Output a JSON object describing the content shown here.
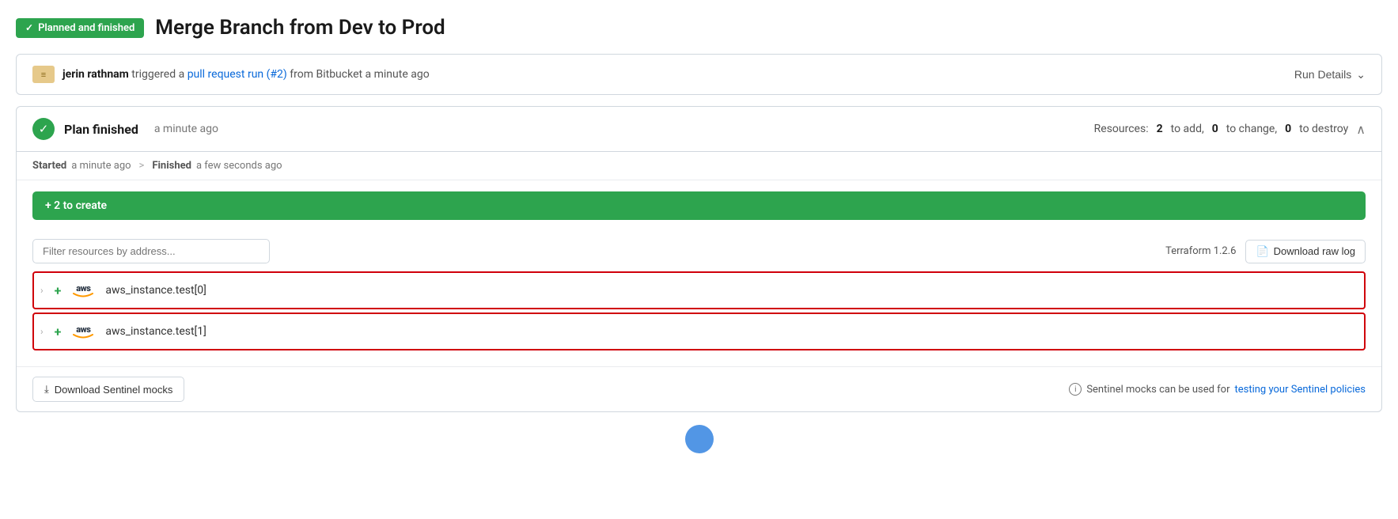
{
  "header": {
    "badge_label": "Planned and finished",
    "title": "Merge Branch from Dev to Prod"
  },
  "trigger_bar": {
    "user": "jerin rathnam",
    "action_text": "triggered a",
    "link_text": "pull request run (#2)",
    "source_text": "from Bitbucket a minute ago",
    "run_details_label": "Run Details"
  },
  "plan_card": {
    "title": "Plan finished",
    "time": "a minute ago",
    "resources_text": "Resources:",
    "to_add": "2",
    "to_add_label": "to add,",
    "to_change": "0",
    "to_change_label": "to change,",
    "to_destroy": "0",
    "to_destroy_label": "to destroy",
    "timing": {
      "started_label": "Started",
      "started_time": "a minute ago",
      "arrow": ">",
      "finished_label": "Finished",
      "finished_time": "a few seconds ago"
    },
    "create_bar_label": "+ 2 to create",
    "filter_placeholder": "Filter resources by address...",
    "terraform_version": "Terraform 1.2.6",
    "download_raw_log_label": "Download raw log",
    "resources": [
      {
        "name": "aws_instance.test[0]"
      },
      {
        "name": "aws_instance.test[1]"
      }
    ],
    "footer": {
      "download_sentinel_label": "Download Sentinel mocks",
      "sentinel_info_text": "Sentinel mocks can be used for",
      "sentinel_link_text": "testing your Sentinel policies"
    }
  }
}
